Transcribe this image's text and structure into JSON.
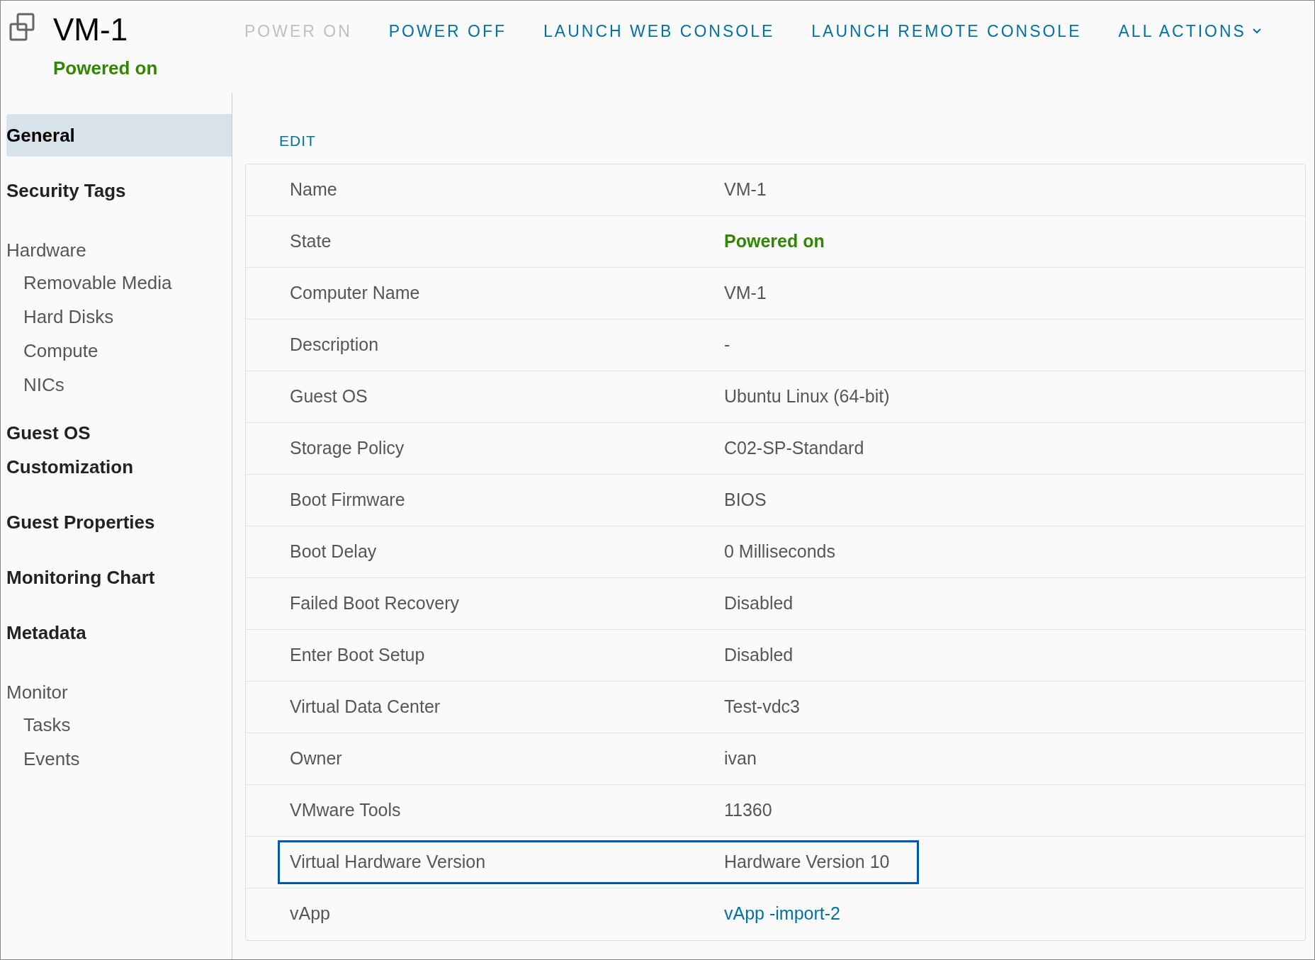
{
  "header": {
    "title": "VM-1",
    "status": "Powered on"
  },
  "actions": [
    {
      "label": "POWER ON",
      "disabled": true,
      "kind": "button"
    },
    {
      "label": "POWER OFF",
      "disabled": false,
      "kind": "button"
    },
    {
      "label": "LAUNCH WEB CONSOLE",
      "disabled": false,
      "kind": "button"
    },
    {
      "label": "LAUNCH REMOTE CONSOLE",
      "disabled": false,
      "kind": "button"
    },
    {
      "label": "ALL ACTIONS",
      "disabled": false,
      "kind": "menu"
    }
  ],
  "sidebar": {
    "items": [
      {
        "label": "General",
        "kind": "item",
        "selected": true
      },
      {
        "label": "Security Tags",
        "kind": "item",
        "selected": false
      },
      {
        "label": "Hardware",
        "kind": "section",
        "children": [
          {
            "label": "Removable Media",
            "selected": false
          },
          {
            "label": "Hard Disks",
            "selected": false
          },
          {
            "label": "Compute",
            "selected": false
          },
          {
            "label": "NICs",
            "selected": false
          }
        ]
      },
      {
        "label": "Guest OS Customization",
        "kind": "item",
        "selected": false
      },
      {
        "label": "Guest Properties",
        "kind": "item",
        "selected": false
      },
      {
        "label": "Monitoring Chart",
        "kind": "item",
        "selected": false
      },
      {
        "label": "Metadata",
        "kind": "item",
        "selected": false
      },
      {
        "label": "Monitor",
        "kind": "section",
        "children": [
          {
            "label": "Tasks",
            "selected": false
          },
          {
            "label": "Events",
            "selected": false
          }
        ]
      }
    ]
  },
  "edit_link": "EDIT",
  "properties": [
    {
      "label": "Name",
      "value": "VM-1",
      "kind": "text",
      "highlighted": false
    },
    {
      "label": "State",
      "value": "Powered on",
      "kind": "status",
      "highlighted": false
    },
    {
      "label": "Computer Name",
      "value": "VM-1",
      "kind": "text",
      "highlighted": false
    },
    {
      "label": "Description",
      "value": "-",
      "kind": "text",
      "highlighted": false
    },
    {
      "label": "Guest OS",
      "value": "Ubuntu Linux (64-bit)",
      "kind": "text",
      "highlighted": false
    },
    {
      "label": "Storage Policy",
      "value": "C02-SP-Standard",
      "kind": "text",
      "highlighted": false
    },
    {
      "label": "Boot Firmware",
      "value": "BIOS",
      "kind": "text",
      "highlighted": false
    },
    {
      "label": "Boot Delay",
      "value": "0 Milliseconds",
      "kind": "text",
      "highlighted": false
    },
    {
      "label": "Failed Boot Recovery",
      "value": "Disabled",
      "kind": "text",
      "highlighted": false
    },
    {
      "label": "Enter Boot Setup",
      "value": "Disabled",
      "kind": "text",
      "highlighted": false
    },
    {
      "label": "Virtual Data Center",
      "value": "Test-vdc3",
      "kind": "text",
      "highlighted": false
    },
    {
      "label": "Owner",
      "value": "ivan",
      "kind": "text",
      "highlighted": false
    },
    {
      "label": "VMware Tools",
      "value": "11360",
      "kind": "text",
      "highlighted": false
    },
    {
      "label": "Virtual Hardware Version",
      "value": "Hardware Version 10",
      "kind": "text",
      "highlighted": true
    },
    {
      "label": "vApp",
      "value": "vApp -import-2",
      "kind": "link",
      "highlighted": false
    }
  ]
}
